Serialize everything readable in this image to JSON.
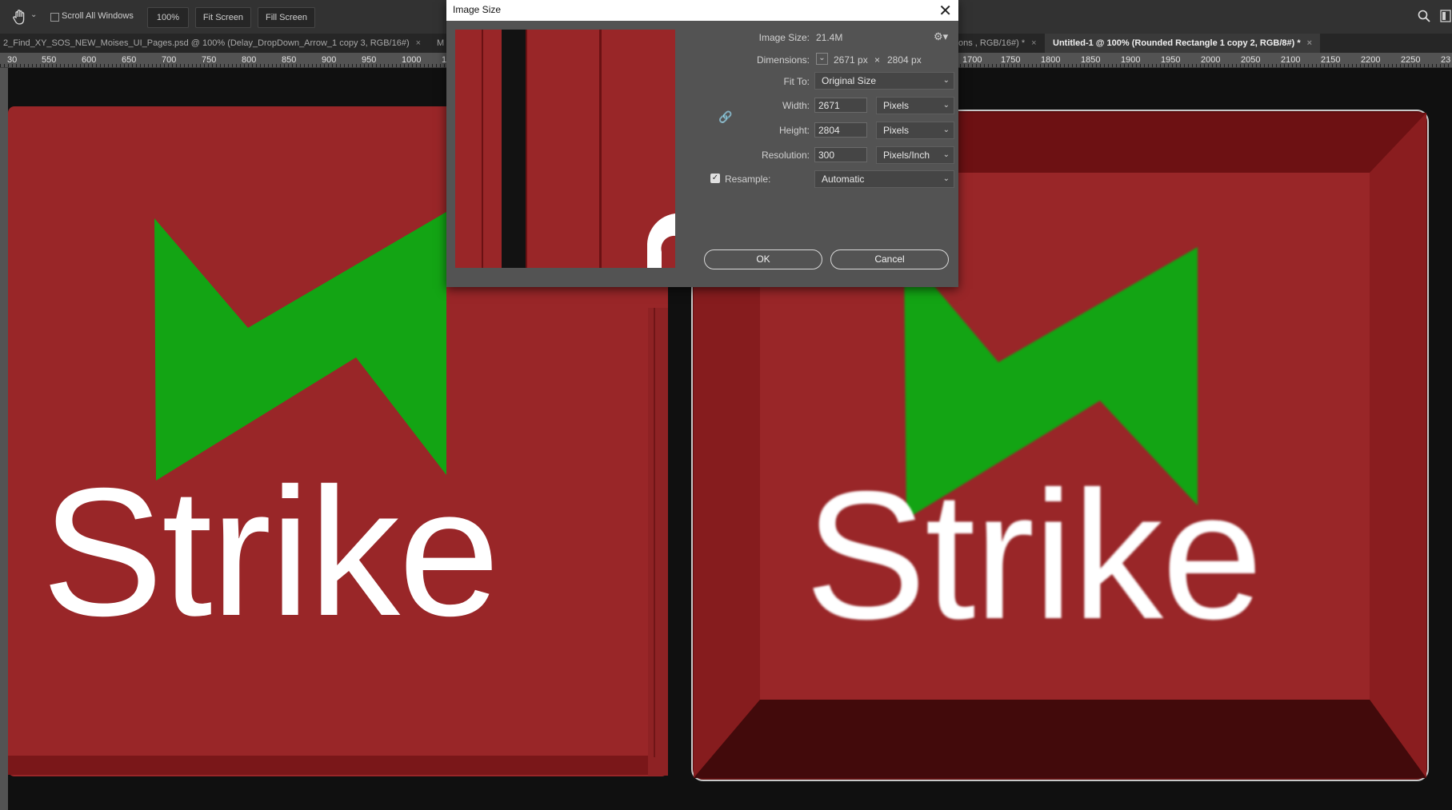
{
  "options_bar": {
    "scroll_all_windows": "Scroll All Windows",
    "zoom_100": "100%",
    "fit_screen": "Fit Screen",
    "fill_screen": "Fill Screen"
  },
  "tabs": [
    {
      "label": "2_Find_XY_SOS_NEW_Moises_UI_Pages.psd @ 100% (Delay_DropDown_Arrow_1 copy 3, RGB/16#)",
      "close": "×"
    },
    {
      "label": "M",
      "close": ""
    },
    {
      "label": "ons , RGB/16#) *",
      "close": "×"
    },
    {
      "label": "Untitled-1 @ 100% (Rounded Rectangle 1 copy 2, RGB/8#) *",
      "close": "×"
    }
  ],
  "ruler": {
    "left_labels": [
      "30",
      "550",
      "600",
      "650",
      "700",
      "750",
      "800",
      "850",
      "900",
      "950",
      "1000",
      "1"
    ],
    "right_labels": [
      "1700",
      "1750",
      "1800",
      "1850",
      "1900",
      "1950",
      "2000",
      "2050",
      "2100",
      "2150",
      "2200",
      "2250",
      "23"
    ]
  },
  "canvas": {
    "left_button_text": "Strike",
    "right_button_text": "Strike",
    "colors": {
      "red": "#992628",
      "dark_red": "#6e1113",
      "green": "#13a414",
      "bg": "#101010"
    }
  },
  "dialog": {
    "title": "Image Size",
    "image_size_label": "Image Size:",
    "image_size_value": "21.4M",
    "dimensions_label": "Dimensions:",
    "dim_width": "2671 px",
    "dim_times": "×",
    "dim_height": "2804 px",
    "fit_to_label": "Fit To:",
    "fit_to_value": "Original Size",
    "width_label": "Width:",
    "width_value": "2671",
    "width_unit": "Pixels",
    "height_label": "Height:",
    "height_value": "2804",
    "height_unit": "Pixels",
    "resolution_label": "Resolution:",
    "resolution_value": "300",
    "resolution_unit": "Pixels/Inch",
    "resample_label": "Resample:",
    "resample_checked": true,
    "resample_value": "Automatic",
    "ok": "OK",
    "cancel": "Cancel"
  }
}
